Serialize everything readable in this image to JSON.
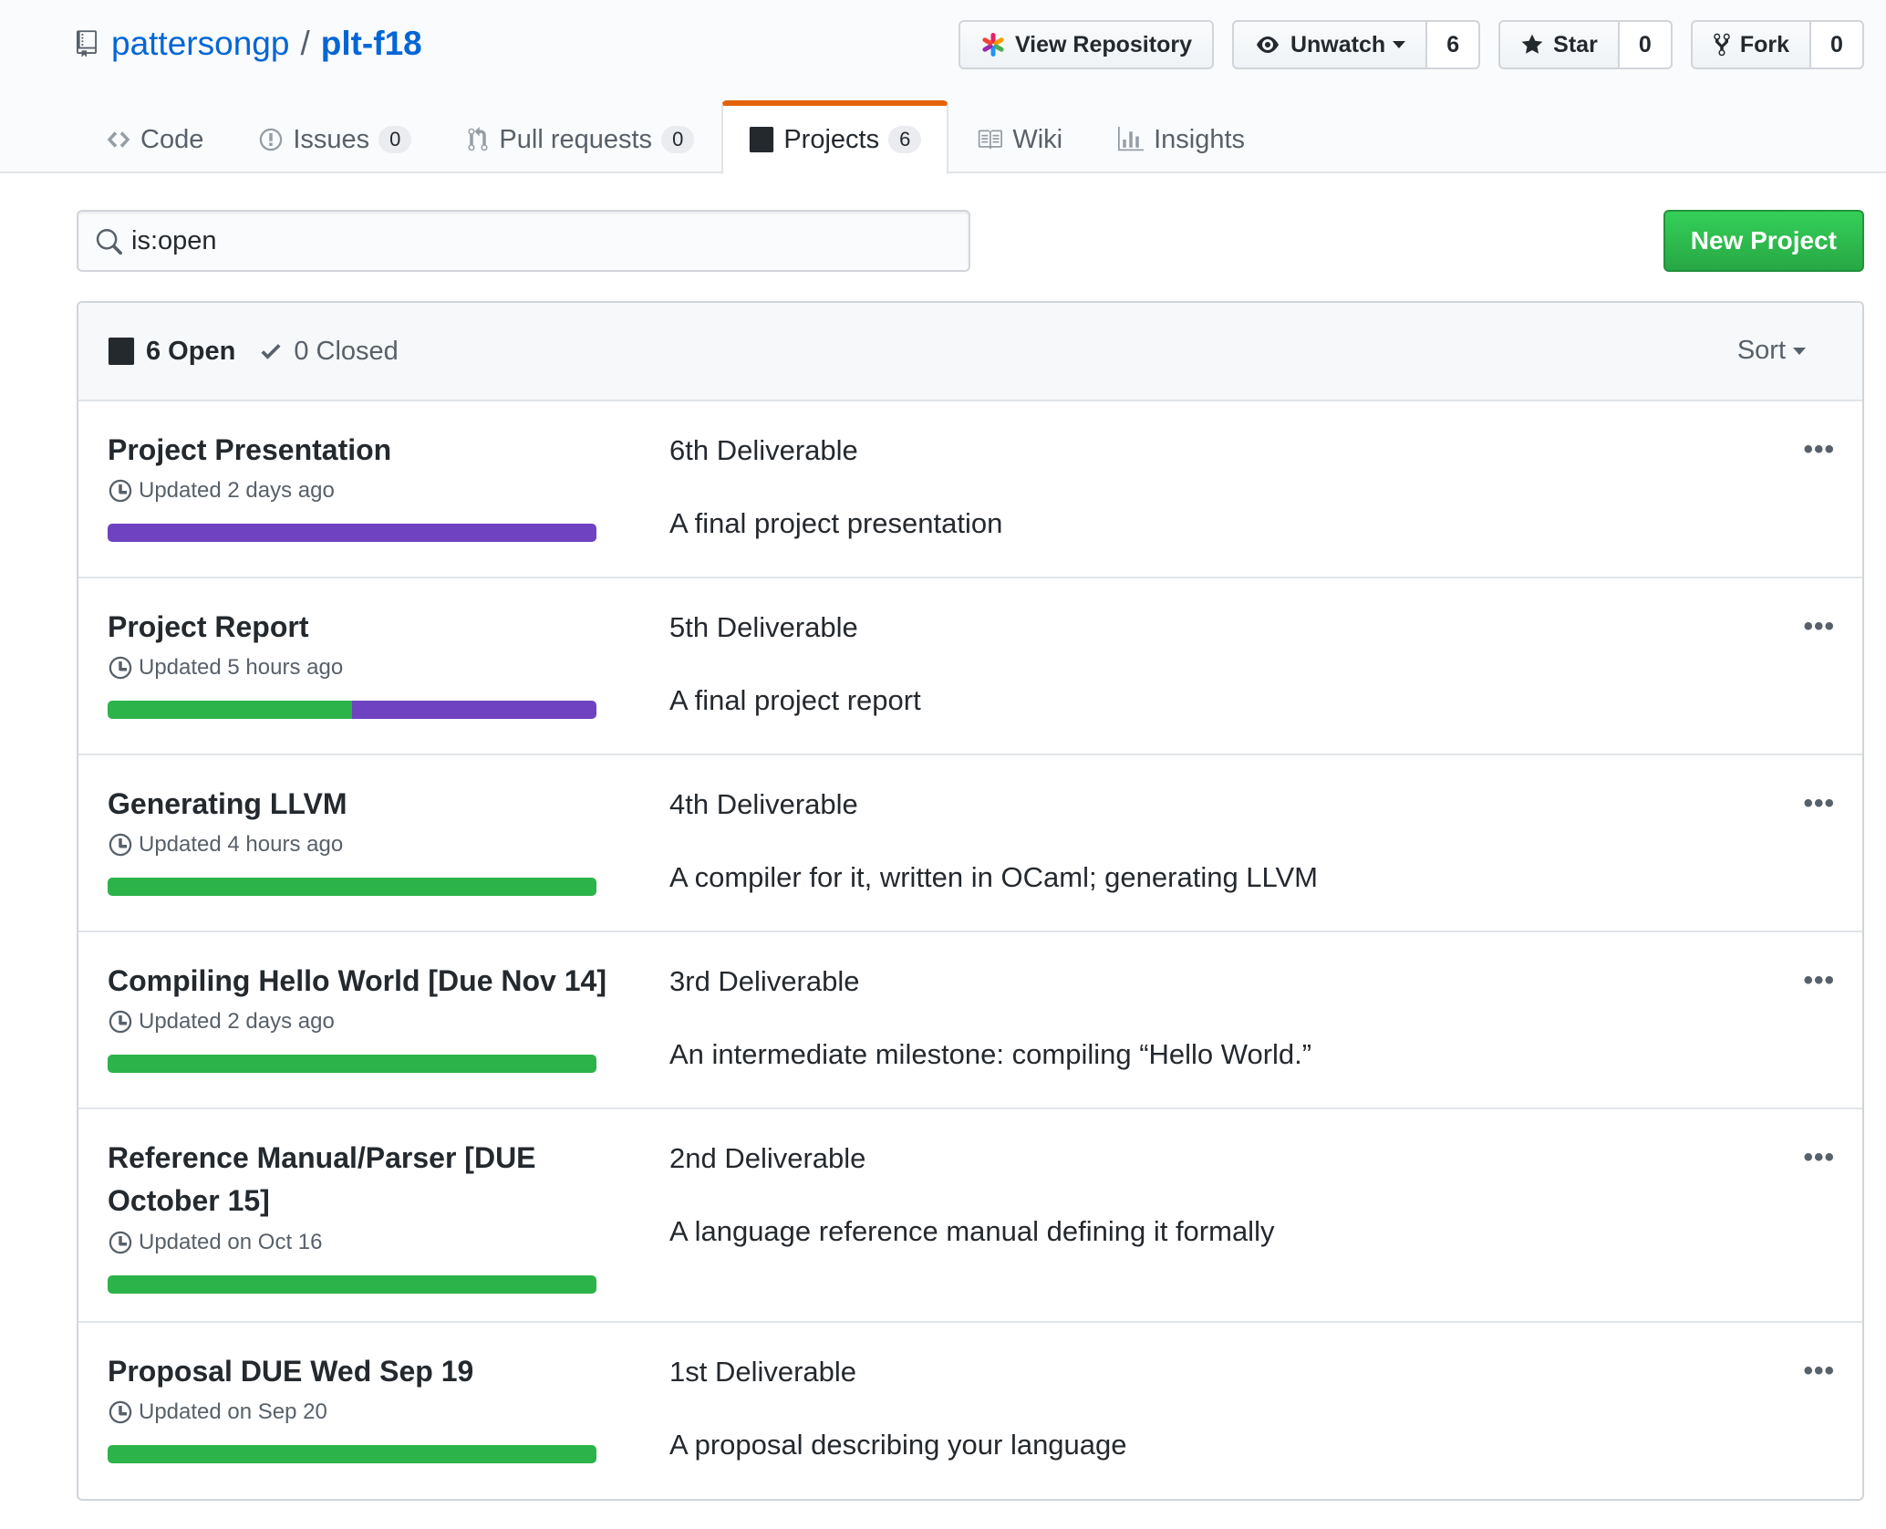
{
  "repo": {
    "owner": "pattersongp",
    "separator": "/",
    "name": "plt-f18"
  },
  "actions": {
    "view_repository": "View Repository",
    "unwatch": {
      "label": "Unwatch",
      "count": "6"
    },
    "star": {
      "label": "Star",
      "count": "0"
    },
    "fork": {
      "label": "Fork",
      "count": "0"
    }
  },
  "tabs": [
    {
      "label": "Code",
      "icon": "code-icon"
    },
    {
      "label": "Issues",
      "count": "0",
      "icon": "issue-icon"
    },
    {
      "label": "Pull requests",
      "count": "0",
      "icon": "pull-request-icon"
    },
    {
      "label": "Projects",
      "count": "6",
      "icon": "project-icon",
      "selected": true
    },
    {
      "label": "Wiki",
      "icon": "book-icon"
    },
    {
      "label": "Insights",
      "icon": "graph-icon"
    }
  ],
  "search": {
    "value": "is:open"
  },
  "new_project_label": "New Project",
  "header": {
    "open": "6 Open",
    "closed": "0 Closed",
    "sort": "Sort"
  },
  "colors": {
    "accent_tab": "#e36209",
    "link": "#0366d6",
    "done": "#2cb34a",
    "in_progress": "#6f42c1",
    "primary_button": "#28a745"
  },
  "projects": [
    {
      "name": "Project Presentation",
      "updated": "Updated 2 days ago",
      "deliverable": "6th Deliverable",
      "description": "A final project presentation",
      "progress": {
        "done": 0,
        "in_progress": 1.0
      }
    },
    {
      "name": "Project Report",
      "updated": "Updated 5 hours ago",
      "deliverable": "5th Deliverable",
      "description": "A final project report",
      "progress": {
        "done": 0.5,
        "in_progress": 0.5
      }
    },
    {
      "name": "Generating LLVM",
      "updated": "Updated 4 hours ago",
      "deliverable": "4th Deliverable",
      "description": "A compiler for it, written in OCaml; generating LLVM",
      "progress": {
        "done": 1.0,
        "in_progress": 0
      }
    },
    {
      "name": "Compiling Hello World [Due Nov 14]",
      "updated": "Updated 2 days ago",
      "deliverable": "3rd Deliverable",
      "description": "An intermediate milestone: compiling “Hello World.”",
      "progress": {
        "done": 1.0,
        "in_progress": 0
      }
    },
    {
      "name": "Reference Manual/Parser [DUE October 15]",
      "updated": "Updated on Oct 16",
      "deliverable": "2nd Deliverable",
      "description": "A language reference manual defining it formally",
      "progress": {
        "done": 1.0,
        "in_progress": 0
      }
    },
    {
      "name": "Proposal DUE Wed Sep 19",
      "updated": "Updated on Sep 20",
      "deliverable": "1st Deliverable",
      "description": "A proposal describing your language",
      "progress": {
        "done": 1.0,
        "in_progress": 0
      }
    }
  ],
  "more_label": "•••"
}
